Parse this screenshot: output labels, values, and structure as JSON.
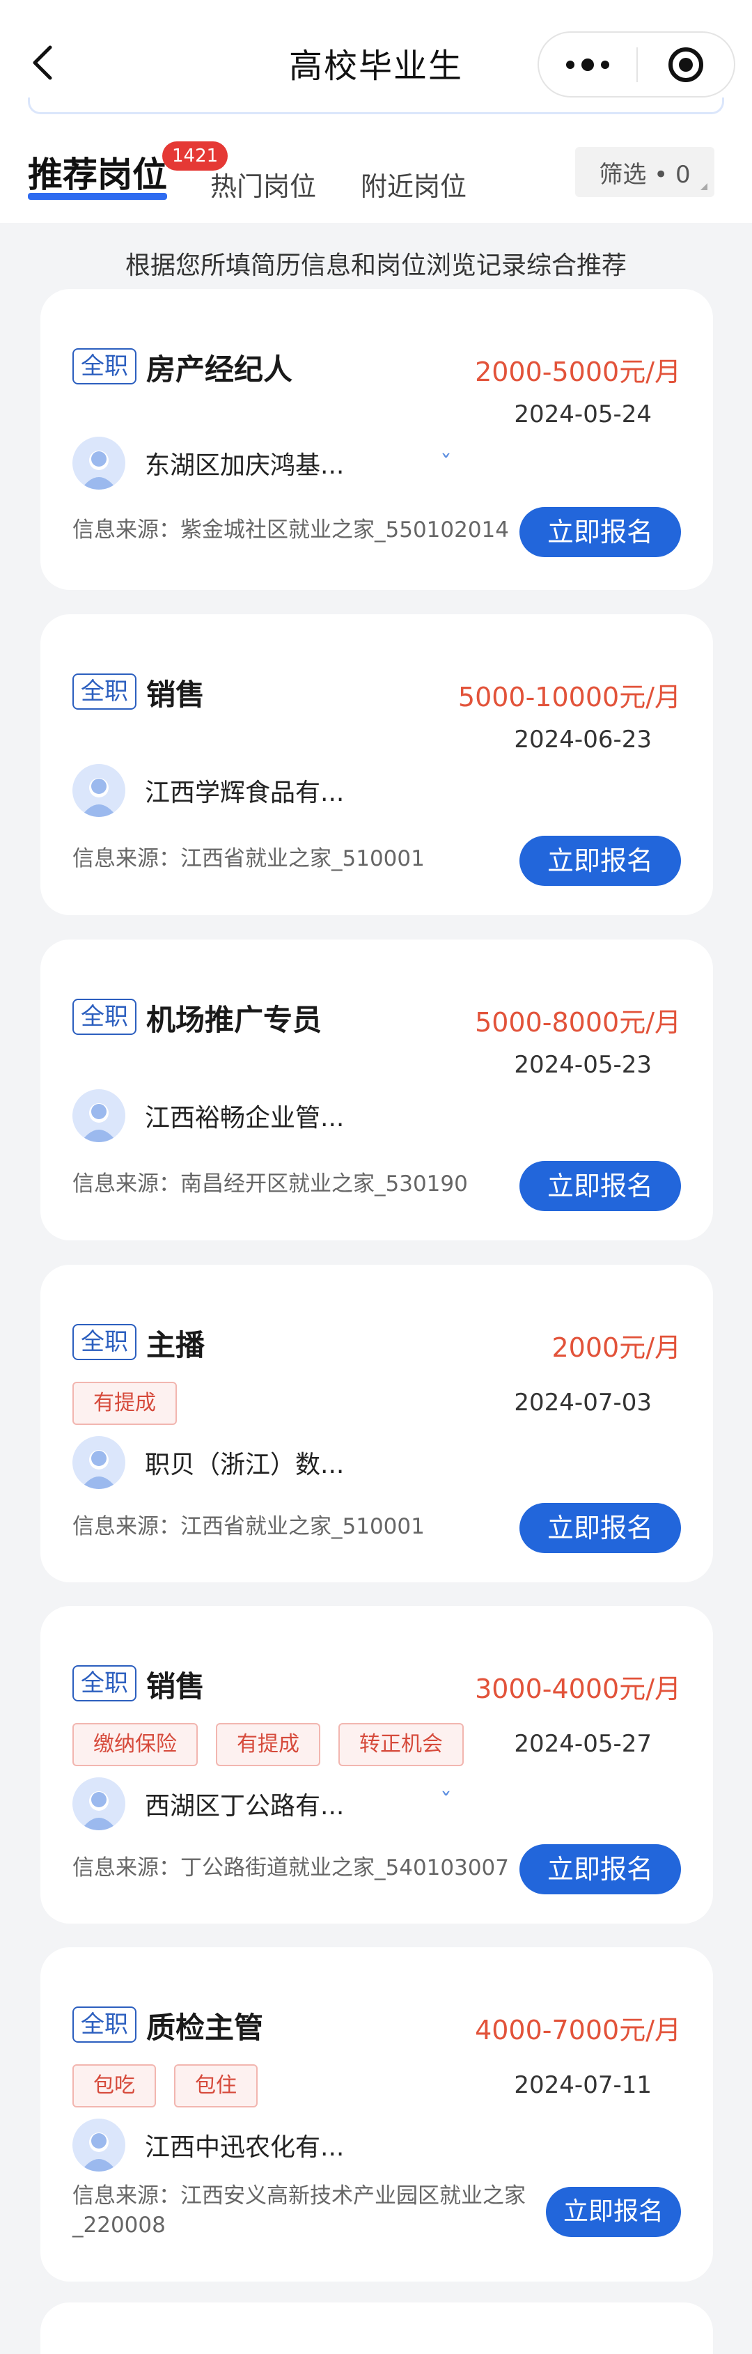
{
  "header": {
    "title": "高校毕业生",
    "icons": {
      "back": "chevron-left-icon",
      "more": "more-dots-icon",
      "close": "target-close-icon"
    }
  },
  "tabs": {
    "recommend": "推荐岗位",
    "recommend_count": "1421",
    "hot": "热门岗位",
    "nearby": "附近岗位",
    "filter": "筛选 • 0"
  },
  "subtitle": "根据您所填简历信息和岗位浏览记录综合推荐",
  "colors": {
    "primary": "#2266db",
    "salary": "#e2533a",
    "badge": "#e53935"
  },
  "jobs": [
    {
      "type": "全职",
      "title": "房产经纪人",
      "salary": "2000-5000元/月",
      "date": "2024-05-24",
      "perks": [],
      "company": "东湖区加庆鸿基...",
      "source": "信息来源：紫金城社区就业之家_550102014",
      "apply": "立即报名"
    },
    {
      "type": "全职",
      "title": "销售",
      "salary": "5000-10000元/月",
      "date": "2024-06-23",
      "perks": [],
      "company": "江西学辉食品有...",
      "source": "信息来源：江西省就业之家_510001",
      "apply": "立即报名"
    },
    {
      "type": "全职",
      "title": "机场推广专员",
      "salary": "5000-8000元/月",
      "date": "2024-05-23",
      "perks": [],
      "company": "江西裕畅企业管...",
      "source": "信息来源：南昌经开区就业之家_530190",
      "apply": "立即报名"
    },
    {
      "type": "全职",
      "title": "主播",
      "salary": "2000元/月",
      "date": "2024-07-03",
      "perks": [
        "有提成"
      ],
      "company": "职贝（浙江）数...",
      "source": "信息来源：江西省就业之家_510001",
      "apply": "立即报名"
    },
    {
      "type": "全职",
      "title": "销售",
      "salary": "3000-4000元/月",
      "date": "2024-05-27",
      "perks": [
        "缴纳保险",
        "有提成",
        "转正机会"
      ],
      "company": "西湖区丁公路有...",
      "source": "信息来源：丁公路街道就业之家_540103007",
      "apply": "立即报名"
    },
    {
      "type": "全职",
      "title": "质检主管",
      "salary": "4000-7000元/月",
      "date": "2024-07-11",
      "perks": [
        "包吃",
        "包住"
      ],
      "company": "江西中迅农化有...",
      "source": "信息来源：江西安义高新技术产业园区就业之家_220008",
      "apply": "立即报名"
    }
  ]
}
